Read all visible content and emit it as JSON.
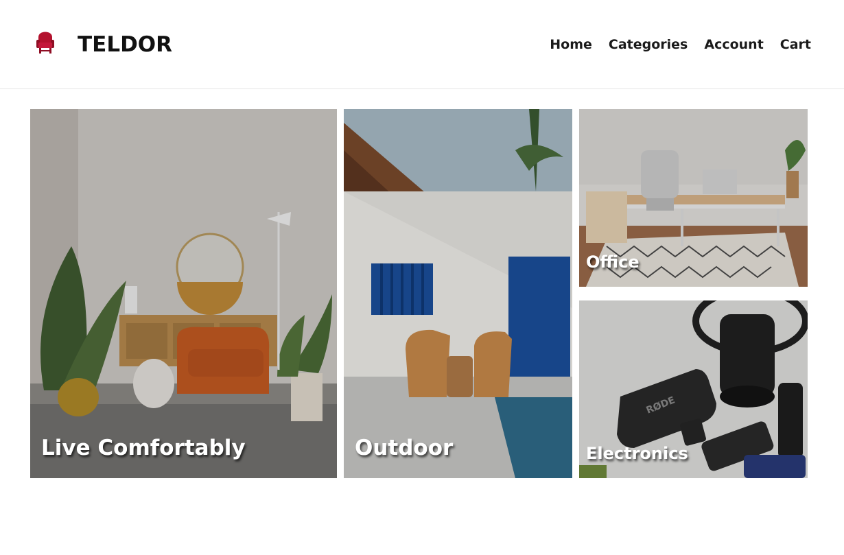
{
  "brand": {
    "name": "TELDOR",
    "logo_icon": "armchair-icon",
    "logo_color": "#b3122e"
  },
  "nav": {
    "items": [
      {
        "label": "Home"
      },
      {
        "label": "Categories"
      },
      {
        "label": "Account"
      },
      {
        "label": "Cart"
      }
    ]
  },
  "categories": {
    "live": {
      "label": "Live Comfortably"
    },
    "outdoor": {
      "label": "Outdoor"
    },
    "office": {
      "label": "Office"
    },
    "electronics": {
      "label": "Electronics"
    }
  }
}
